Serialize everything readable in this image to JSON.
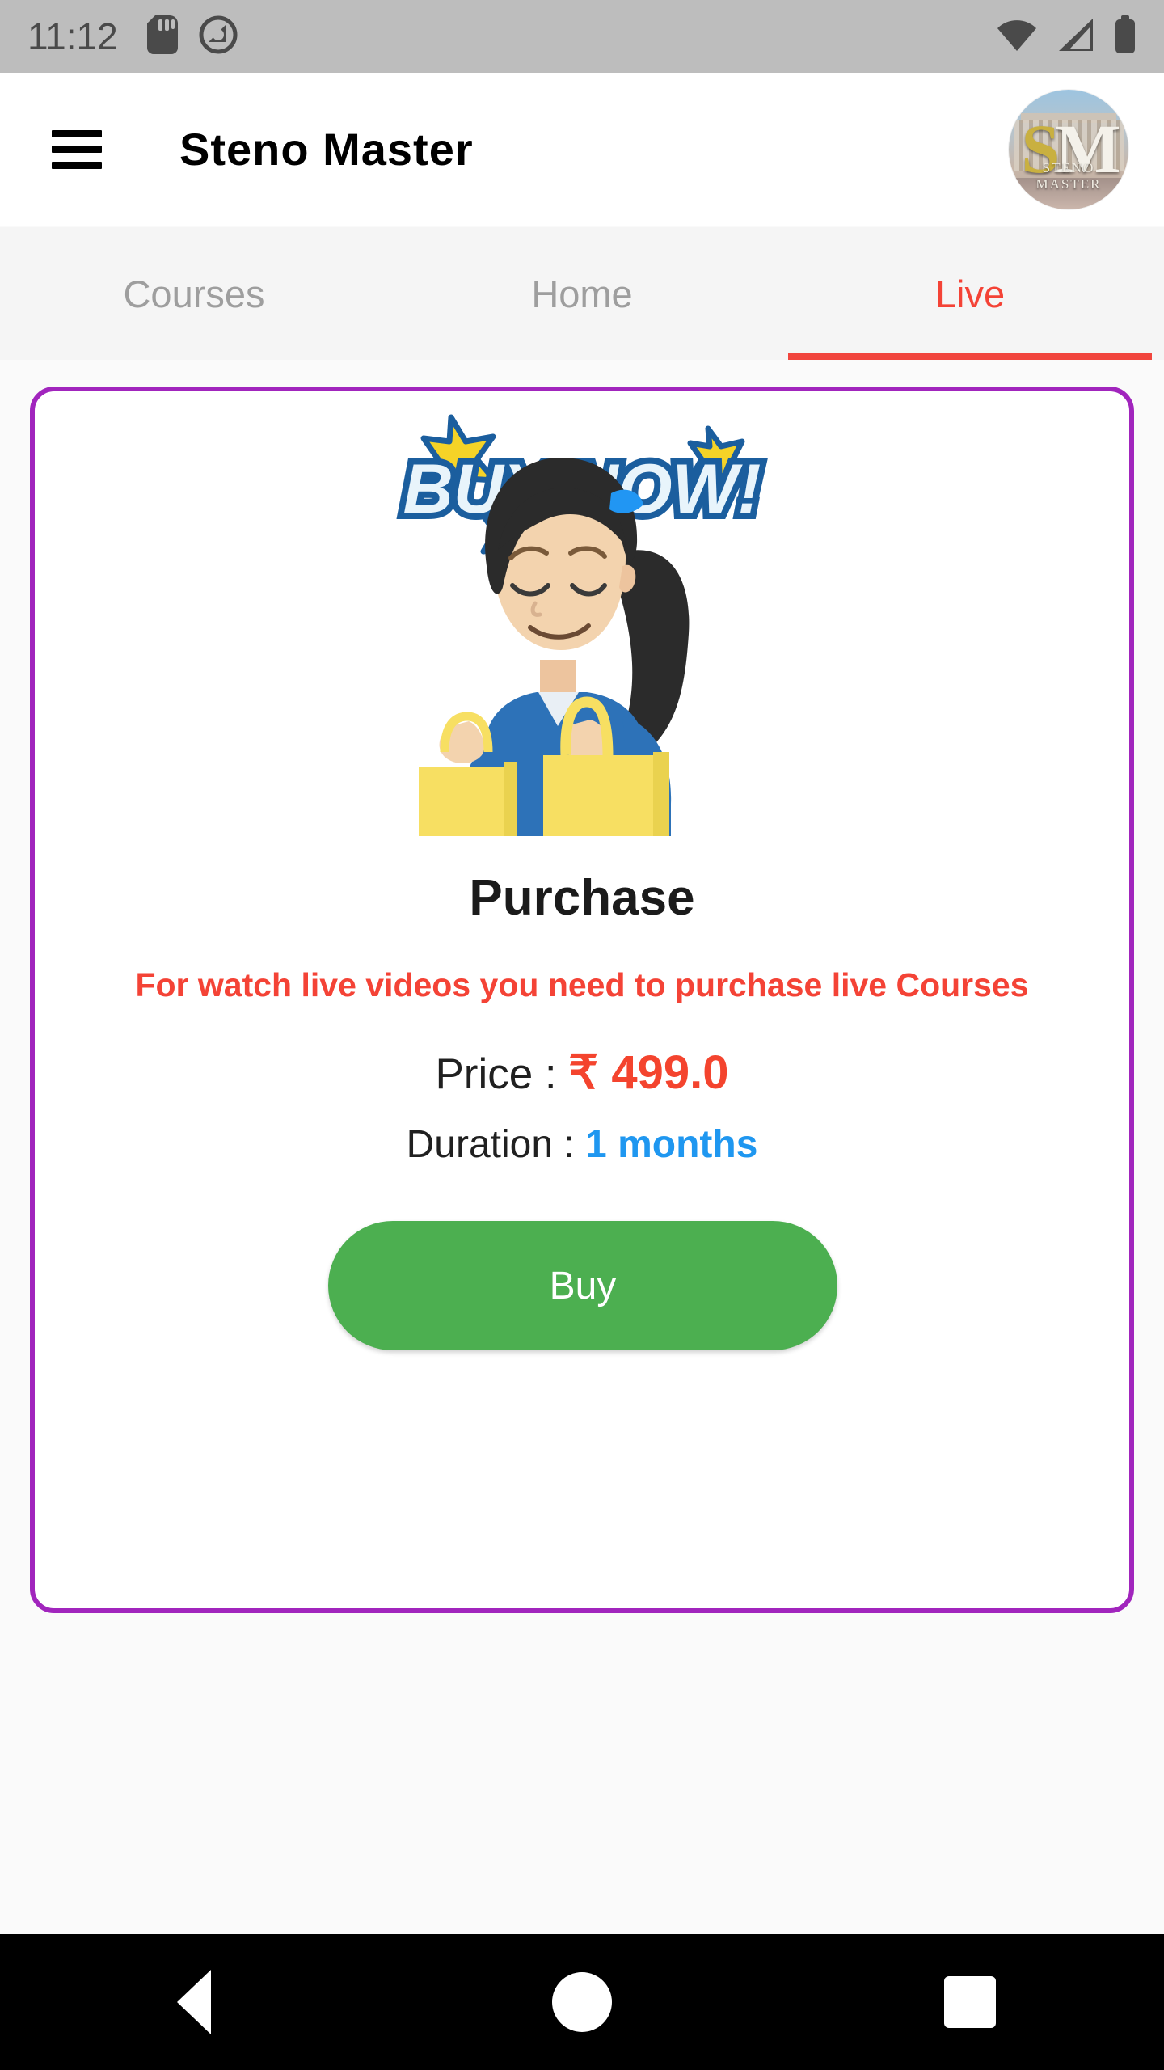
{
  "status_bar": {
    "time": "11:12",
    "left_icons": [
      "sd-card-icon",
      "data-saver-icon"
    ],
    "right_icons": [
      "wifi-icon",
      "cellular-signal-icon",
      "battery-icon"
    ],
    "background_color": "#bdbdbd"
  },
  "app_bar": {
    "menu_icon": "hamburger-menu-icon",
    "title": "Steno Master",
    "avatar": {
      "monogram_s": "S",
      "monogram_m": "M",
      "brand_text": "STENO MASTER"
    }
  },
  "tabs": {
    "items": [
      {
        "label": "Courses",
        "active": false
      },
      {
        "label": "Home",
        "active": false
      },
      {
        "label": "Live",
        "active": true
      }
    ],
    "active_color": "#f44336",
    "inactive_color": "#9e9e9e"
  },
  "card": {
    "border_color": "#a125bd",
    "banner": {
      "text": "BUY NOW!",
      "text_fill": "#e8f4fb",
      "text_outline": "#1b5e9e",
      "star_fill": "#f5d327",
      "star_outline": "#1b5e9e"
    },
    "illustration": {
      "name": "woman-with-shopping-bags-illustration",
      "hair_color": "#2b2b2b",
      "shirt_color": "#2d72b8",
      "bag_color": "#f7df62",
      "skin_color": "#f3d3ae",
      "hairband_color": "#2196f3"
    },
    "title": "Purchase",
    "description": "For watch live videos you need to purchase live Courses",
    "price_label": "Price : ",
    "price_value": "₹ 499.0",
    "price_color": "#f4442e",
    "duration_label": "Duration : ",
    "duration_value": "1 months",
    "duration_color": "#1f97f0",
    "buy_button_label": "Buy",
    "buy_button_color": "#4caf50"
  },
  "nav_bar": {
    "back_icon": "back-triangle-icon",
    "home_icon": "home-circle-icon",
    "recents_icon": "recents-square-icon",
    "background_color": "#000000"
  }
}
